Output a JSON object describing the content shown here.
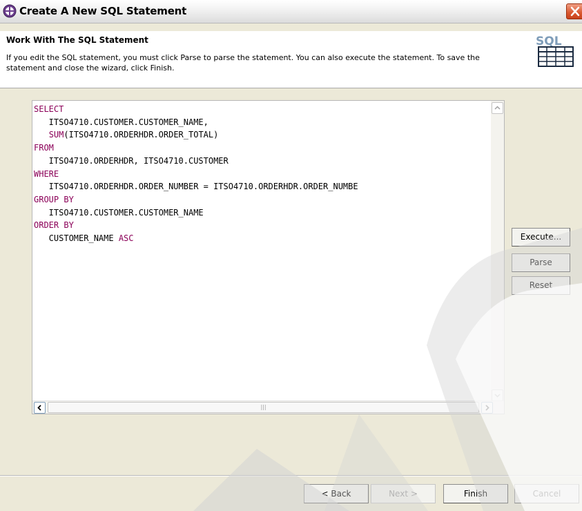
{
  "window": {
    "title": "Create A New SQL Statement"
  },
  "header": {
    "title": "Work With The SQL Statement",
    "description": "If you edit the SQL statement, you must click Parse to parse the statement. You can also execute the statement. To save the statement and close the wizard, click Finish.",
    "icon_text": "SQL"
  },
  "editor": {
    "lines": [
      [
        {
          "t": "SELECT",
          "kw": true
        }
      ],
      [
        {
          "t": "   ITSO4710.CUSTOMER.CUSTOMER_NAME,",
          "kw": false
        }
      ],
      [
        {
          "t": "   ",
          "kw": false
        },
        {
          "t": "SUM",
          "kw": true
        },
        {
          "t": "(ITSO4710.ORDERHDR.ORDER_TOTAL)",
          "kw": false
        }
      ],
      [
        {
          "t": "FROM",
          "kw": true
        }
      ],
      [
        {
          "t": "   ITSO4710.ORDERHDR, ITSO4710.CUSTOMER",
          "kw": false
        }
      ],
      [
        {
          "t": "WHERE",
          "kw": true
        }
      ],
      [
        {
          "t": "   ITSO4710.ORDERHDR.ORDER_NUMBER = ITSO4710.ORDERHDR.ORDER_NUMBE",
          "kw": false
        }
      ],
      [
        {
          "t": "GROUP BY",
          "kw": true
        }
      ],
      [
        {
          "t": "   ITSO4710.CUSTOMER.CUSTOMER_NAME",
          "kw": false
        }
      ],
      [
        {
          "t": "ORDER BY",
          "kw": true
        }
      ],
      [
        {
          "t": "   CUSTOMER_NAME ",
          "kw": false
        },
        {
          "t": "ASC",
          "kw": true
        }
      ]
    ]
  },
  "side_buttons": {
    "execute": "Execute...",
    "parse": "Parse",
    "reset": "Reset"
  },
  "footer": {
    "back": "< Back",
    "next": "Next >",
    "finish": "Finish",
    "cancel": "Cancel"
  },
  "colors": {
    "keyword": "#8b0058",
    "dialog_bg": "#ece9d8"
  }
}
